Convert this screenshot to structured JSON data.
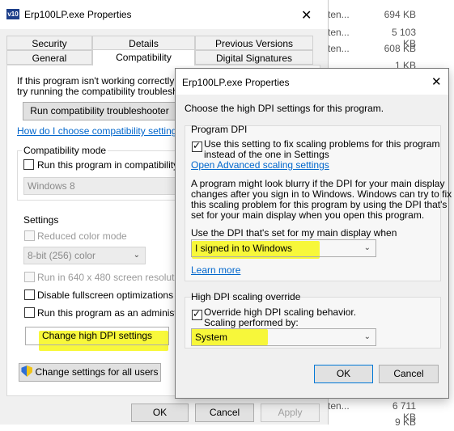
{
  "background_list": [
    {
      "name": "ten...",
      "size": "694 KB"
    },
    {
      "name": "ten...",
      "size": "5 103 KB"
    },
    {
      "name": "ten...",
      "size": "608 KB"
    },
    {
      "name": "",
      "size": "1 KB"
    },
    {
      "name": "ten...",
      "size": "6 711 KB"
    },
    {
      "name": "",
      "size": "9 KB"
    }
  ],
  "main": {
    "icon_text": "v10",
    "title": "Erp100LP.exe Properties",
    "tabs_top": [
      "Security",
      "Details",
      "Previous Versions"
    ],
    "tabs_bottom": [
      "General",
      "Compatibility",
      "Digital Signatures"
    ],
    "intro_line1": "If this program isn't working correctly on th",
    "intro_line2": "try running the compatibility troubleshooter",
    "run_troubleshooter": "Run compatibility troubleshooter",
    "how_link": "How do I choose compatibility settings ma",
    "compat_group": "Compatibility mode",
    "compat_checkbox": "Run this program in compatibility moc",
    "compat_select": "Windows 8",
    "settings_group": "Settings",
    "reduced_color": "Reduced color mode",
    "color_select": "8-bit (256) color",
    "run_640": "Run in 640 x 480 screen resolution",
    "disable_fullscreen": "Disable fullscreen optimizations",
    "run_admin": "Run this program as an administrator",
    "change_dpi": "Change high DPI settings",
    "change_all_users": "Change settings for all users",
    "ok": "OK",
    "cancel": "Cancel",
    "apply": "Apply"
  },
  "dpi": {
    "title": "Erp100LP.exe Properties",
    "heading": "Choose the high DPI settings for this program.",
    "program_dpi_group": "Program DPI",
    "use_setting_line1": "Use this setting to fix scaling problems for this program",
    "use_setting_line2": "instead of the one in Settings",
    "open_advanced_link": "Open Advanced scaling settings",
    "blurry_lines": [
      "A program might look blurry if the DPI for your main display",
      "changes after you sign in to Windows. Windows can try to fix",
      "this scaling problem for this program by using the DPI that's",
      "set for your main display when you open this program."
    ],
    "use_dpi_label": "Use the DPI that's set for my main display when",
    "dpi_when_select": "I signed in to Windows",
    "learn_more": "Learn more",
    "override_group": "High DPI scaling override",
    "override_line1": "Override high DPI scaling behavior.",
    "override_line2": "Scaling performed by:",
    "scaling_select": "System",
    "ok": "OK",
    "cancel": "Cancel"
  },
  "colors": {
    "accent_link": "#0066cc",
    "highlight": "#f7f719",
    "focus_border": "#0078d7"
  }
}
